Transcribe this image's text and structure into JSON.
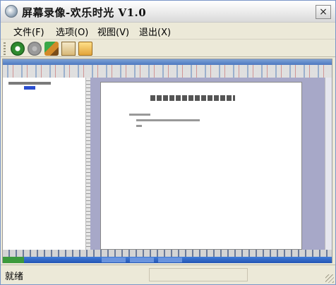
{
  "window": {
    "title": "屏幕录像-欢乐时光 V1.0",
    "close_label": "×"
  },
  "menu": {
    "items": [
      {
        "label": "文件(F)"
      },
      {
        "label": "选项(O)"
      },
      {
        "label": "视图(V)"
      },
      {
        "label": "退出(X)"
      }
    ]
  },
  "toolbar": {
    "buttons": [
      {
        "icon": "record-icon"
      },
      {
        "icon": "stop-icon"
      },
      {
        "icon": "tools-icon"
      },
      {
        "icon": "document-icon"
      },
      {
        "icon": "open-folder-icon"
      }
    ]
  },
  "status": {
    "text": "就绪"
  }
}
